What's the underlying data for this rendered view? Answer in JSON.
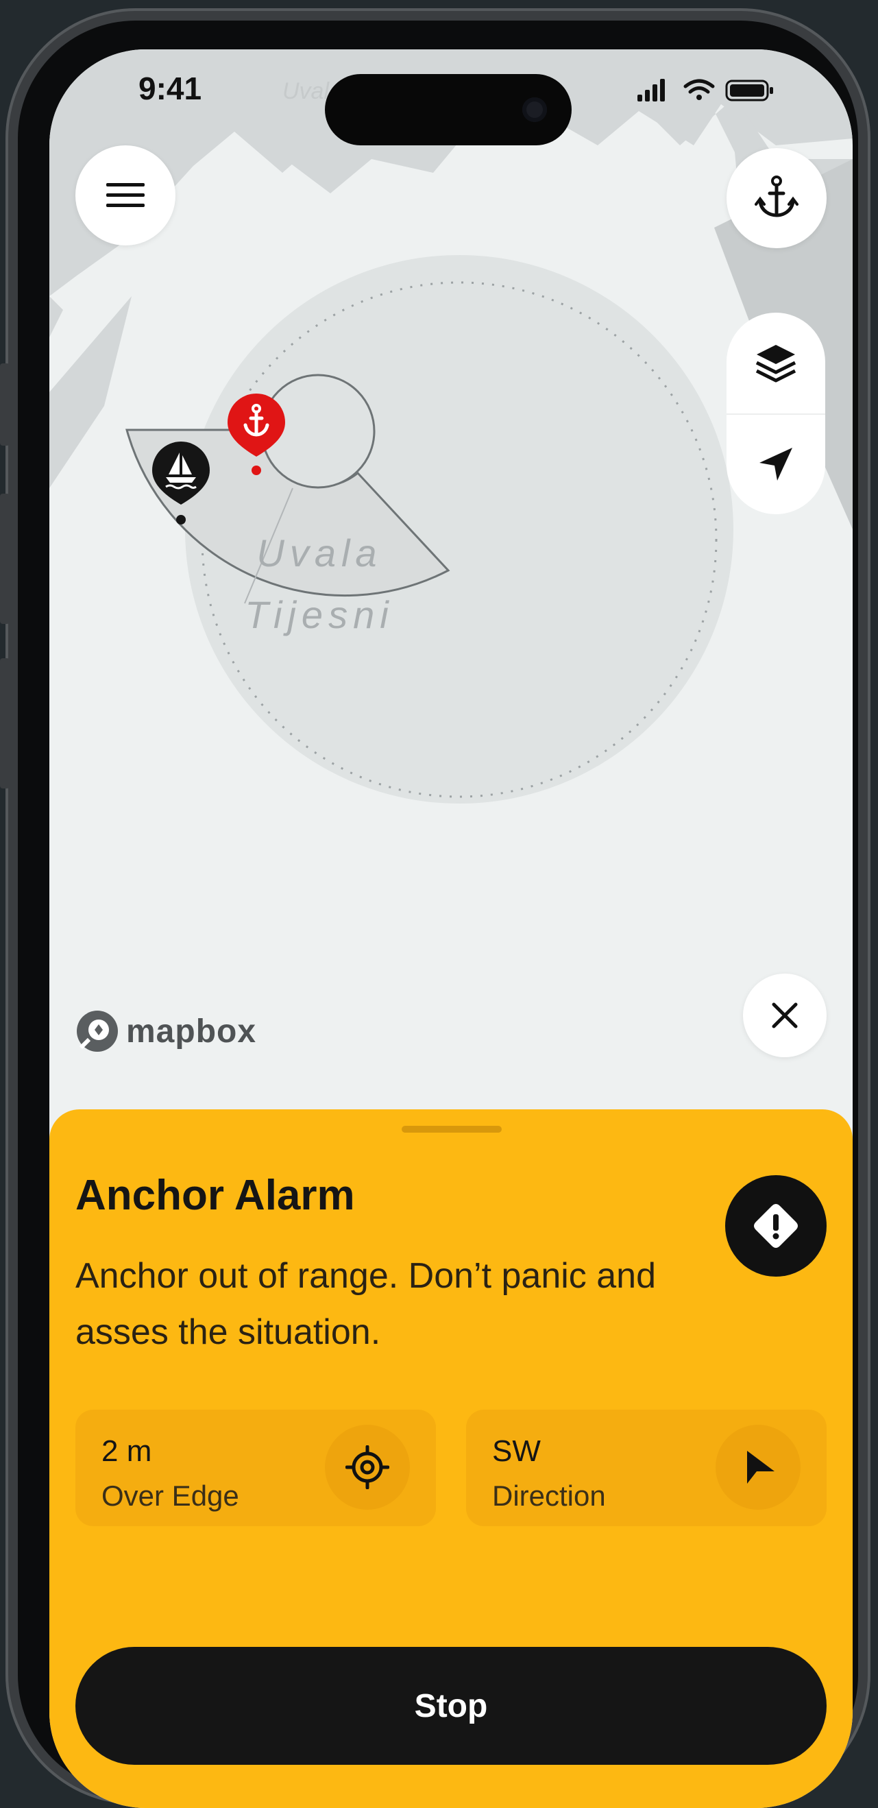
{
  "status_bar": {
    "time": "9:41",
    "icons": [
      "cellular-signal-icon",
      "wifi-icon",
      "battery-icon"
    ]
  },
  "map": {
    "place_label": "Uvala Tijesni",
    "place_label_lines": [
      "Uvala",
      "Tijesni"
    ],
    "attribution": "mapbox",
    "map_top_label": "Uvala Tijesni"
  },
  "controls": {
    "menu_icon": "hamburger-menu-icon",
    "anchor_icon": "anchor-icon",
    "layers_icon": "layers-icon",
    "locate_icon": "navigation-arrow-icon",
    "close_icon": "close-icon"
  },
  "markers": {
    "anchor_marker_icon": "anchor-icon",
    "boat_marker_icon": "sailboat-icon"
  },
  "alarm": {
    "title": "Anchor Alarm",
    "message": "Anchor out of range. Don’t panic and asses the situation.",
    "badge_icon": "warning-diamond-icon",
    "stats": [
      {
        "value": "2 m",
        "label": "Over Edge",
        "icon": "target-icon"
      },
      {
        "value": "SW",
        "label": "Direction",
        "icon": "direction-arrow-icon"
      }
    ],
    "stop_label": "Stop"
  },
  "colors": {
    "accent": "#FDB812",
    "alarm_red": "#E01515",
    "dark": "#151515"
  }
}
